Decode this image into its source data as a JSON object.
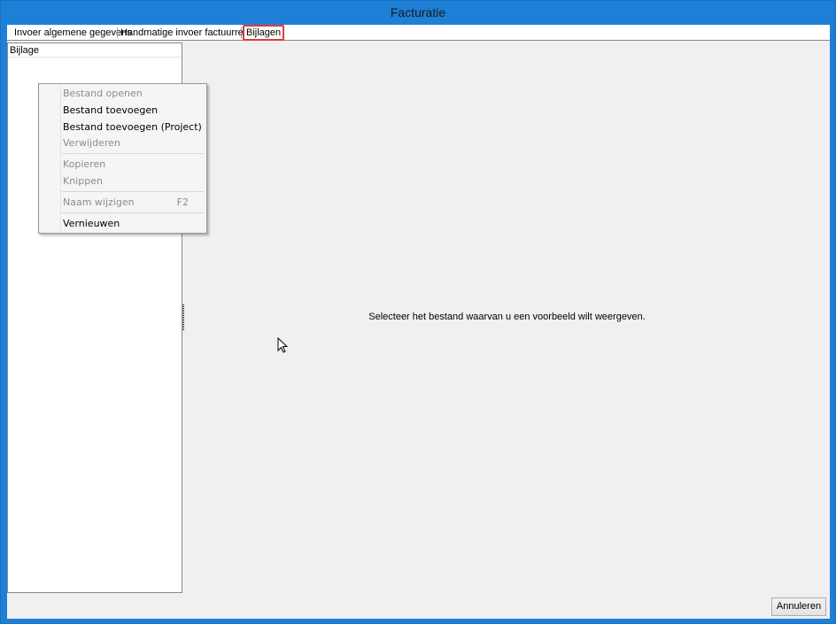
{
  "window": {
    "title": "Facturatie"
  },
  "tabs": [
    {
      "label": "Invoer algemene gegevens"
    },
    {
      "label": "Handmatige invoer factuurregels"
    },
    {
      "label": "Bijlagen",
      "active": true
    }
  ],
  "attachments_list": {
    "column_header": "Bijlage"
  },
  "context_menu": {
    "items": [
      {
        "label": "Bestand openen",
        "enabled": false
      },
      {
        "label": "Bestand toevoegen",
        "enabled": true
      },
      {
        "label": "Bestand toevoegen (Project)",
        "enabled": true
      },
      {
        "label": "Verwijderen",
        "enabled": false
      },
      {
        "label": "Kopieren",
        "enabled": false
      },
      {
        "label": "Knippen",
        "enabled": false
      },
      {
        "label": "Naam wijzigen",
        "shortcut": "F2",
        "enabled": false
      },
      {
        "label": "Vernieuwen",
        "enabled": true
      }
    ]
  },
  "preview": {
    "message": "Selecteer het bestand waarvan u een voorbeeld wilt weergeven."
  },
  "buttons": {
    "cancel": "Annuleren"
  },
  "colors": {
    "title_bar": "#1e7fd6",
    "active_tab_border": "#e0393e",
    "client_bg": "#f0f0f0"
  }
}
